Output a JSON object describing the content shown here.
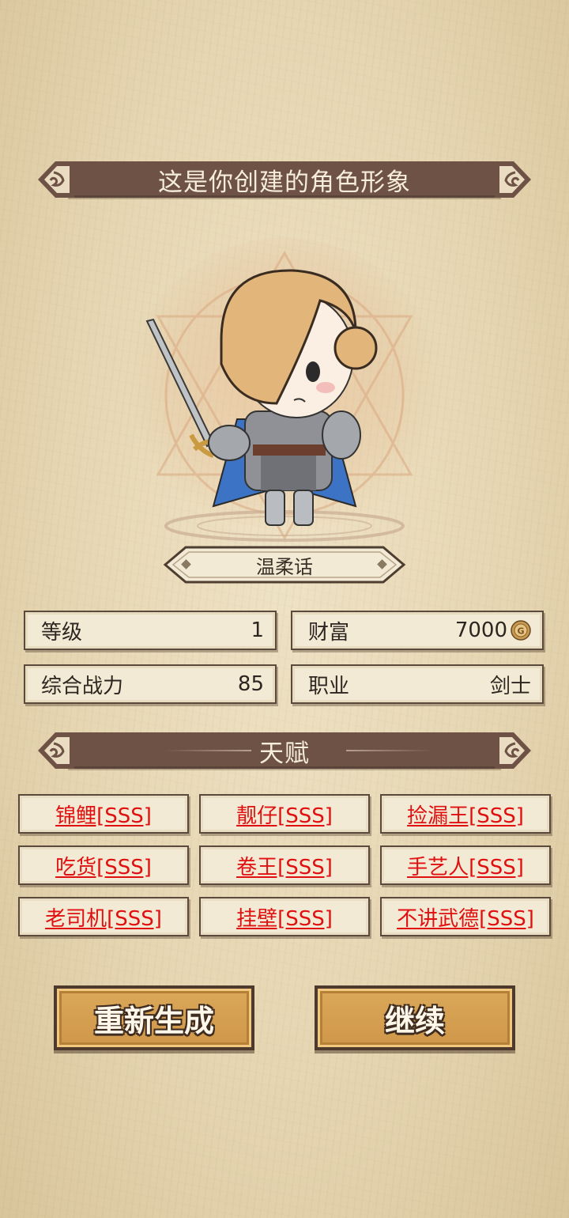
{
  "header": {
    "title": "这是你创建的角色形象"
  },
  "character": {
    "name": "温柔话"
  },
  "stats": {
    "level_label": "等级",
    "level_value": "1",
    "wealth_label": "财富",
    "wealth_value": "7000",
    "power_label": "综合战力",
    "power_value": "85",
    "class_label": "职业",
    "class_value": "剑士"
  },
  "talents": {
    "title": "天赋",
    "items": [
      "锦鲤[SSS]",
      "靓仔[SSS]",
      "捡漏王[SSS]",
      "吃货[SSS]",
      "卷王[SSS]",
      "手艺人[SSS]",
      "老司机[SSS]",
      "挂壁[SSS]",
      "不讲武德[SSS]"
    ]
  },
  "buttons": {
    "regenerate": "重新生成",
    "continue": "继续"
  },
  "colors": {
    "banner": "#6e5245",
    "talent_text": "#e01010",
    "button": "#d9a555",
    "parchment": "#e9dabb"
  },
  "icons": [
    "banner-ornament-icon",
    "coin-icon",
    "diamond-icon"
  ]
}
